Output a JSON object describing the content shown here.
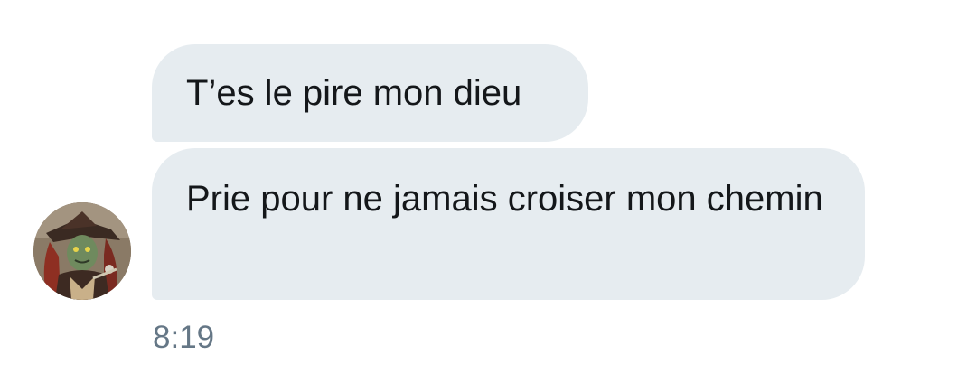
{
  "messages": [
    {
      "text": "T’es le pire mon dieu"
    },
    {
      "text": "Prie pour ne jamais croiser mon chemin"
    }
  ],
  "sender": {
    "avatar_icon": "character-avatar"
  },
  "timestamp": "8:19",
  "colors": {
    "bubble_bg": "#e6ecf0",
    "text": "#14171a",
    "timestamp": "#657786",
    "background": "#ffffff"
  }
}
